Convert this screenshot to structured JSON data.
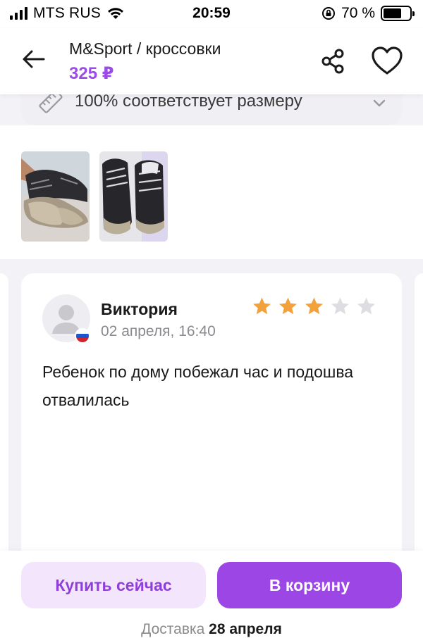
{
  "status_bar": {
    "carrier": "MTS RUS",
    "time": "20:59",
    "battery": "70 %"
  },
  "header": {
    "title": "M&Sport / кроссовки",
    "price": "325 ₽"
  },
  "size_fit": {
    "text": "100% соответствует размеру"
  },
  "review": {
    "author": "Виктория",
    "date": "02 апреля, 16:40",
    "rating": 3,
    "max_rating": 5,
    "text": "Ребенок по дому побежал час и подошва отвалилась"
  },
  "actions": {
    "buy_now_label": "Купить сейчас",
    "add_to_cart_label": "В корзину"
  },
  "delivery": {
    "label": "Доставка",
    "date": "28 апреля"
  },
  "colors": {
    "accent": "#9d46e6",
    "price": "#9b4be8",
    "star_filled": "#f3a23b",
    "star_empty": "#dedde2"
  }
}
